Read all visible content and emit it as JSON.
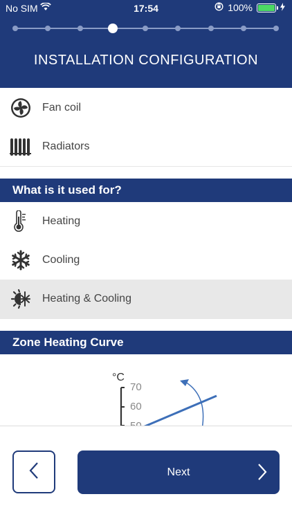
{
  "status_bar": {
    "carrier": "No SIM",
    "time": "17:54",
    "battery": "100%"
  },
  "stepper": {
    "total_steps": 9,
    "current_step": 4
  },
  "header": {
    "title": "INSTALLATION CONFIGURATION"
  },
  "emitters": [
    {
      "label": "Fan coil",
      "icon": "fan-icon"
    },
    {
      "label": "Radiators",
      "icon": "radiator-icon"
    }
  ],
  "usage_section": {
    "title": "What is it used for?",
    "items": [
      {
        "label": "Heating",
        "icon": "thermometer-icon",
        "selected": false
      },
      {
        "label": "Cooling",
        "icon": "snowflake-icon",
        "selected": false
      },
      {
        "label": "Heating & Cooling",
        "icon": "sun-snowflake-icon",
        "selected": true
      }
    ]
  },
  "curve_section": {
    "title": "Zone Heating Curve",
    "unit": "°C",
    "ticks": [
      "70",
      "60",
      "50"
    ]
  },
  "buttons": {
    "next_label": "Next"
  },
  "colors": {
    "primary": "#1f3a7a",
    "selected_bg": "#e8e8e8",
    "curve_line": "#3d6fb8"
  }
}
